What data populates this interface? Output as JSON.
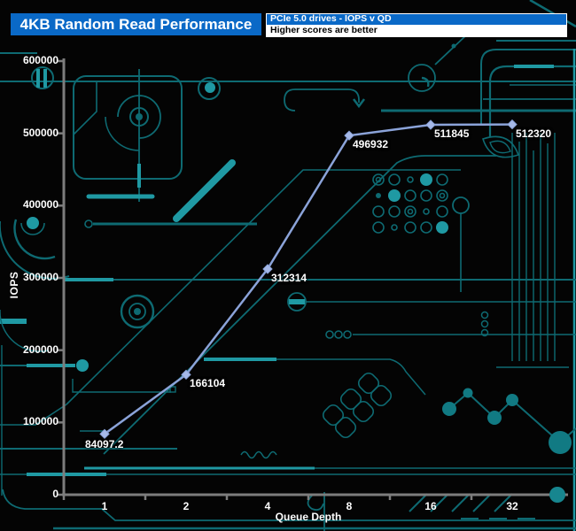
{
  "header": {
    "title": "4KB Random Read Performance",
    "box_line1": "PCIe 5.0 drives - IOPS v QD",
    "box_line2": "Higher scores are better"
  },
  "colors": {
    "header_blue": "#0a69c7",
    "background": "#040404",
    "line": "#8ba3d9",
    "marker": "#a6b9e8",
    "axis_gray": "#7d7d7d",
    "trace_teal": "#0e6a72",
    "trace_bright": "#1f99a3",
    "label_white": "#ffffff"
  },
  "chart_data": {
    "type": "line",
    "title": "4KB Random Read Performance",
    "subtitle": "PCIe 5.0 drives - IOPS v QD",
    "note": "Higher scores are better",
    "xlabel": "Queue Depth",
    "ylabel": "IOPS",
    "x_scale": "categorical (queue depth doubling)",
    "categories": [
      "1",
      "2",
      "4",
      "8",
      "16",
      "32"
    ],
    "series": [
      {
        "name": "PCIe 5.0 drive 4KB random read",
        "values": [
          84097.2,
          166104,
          312314,
          496932,
          511845,
          512320
        ],
        "labels": [
          "84097.2",
          "166104",
          "312314",
          "496932",
          "511845",
          "512320"
        ]
      }
    ],
    "ylim": [
      0,
      600000
    ],
    "ytick_labels": [
      "0",
      "100000",
      "200000",
      "300000",
      "400000",
      "500000",
      "600000"
    ],
    "grid": false,
    "legend": "none",
    "line_color": "#8ba3d9",
    "marker": "diamond"
  }
}
